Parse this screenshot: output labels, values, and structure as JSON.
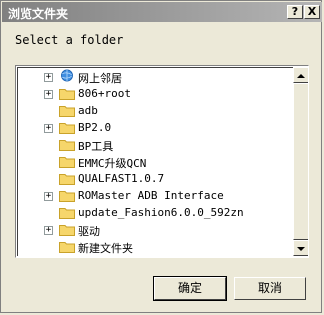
{
  "window": {
    "title": "浏览文件夹",
    "help_label": "?",
    "close_label": "X"
  },
  "prompt": "Select a folder",
  "tree": {
    "items": [
      {
        "label": "网上邻居",
        "expander": "+",
        "icon": "network-places-icon"
      },
      {
        "label": "806+root",
        "expander": "+",
        "icon": "folder-icon"
      },
      {
        "label": "adb",
        "expander": "",
        "icon": "folder-icon"
      },
      {
        "label": "BP2.0",
        "expander": "+",
        "icon": "folder-icon"
      },
      {
        "label": "BP工具",
        "expander": "",
        "icon": "folder-icon"
      },
      {
        "label": "EMMC升级QCN",
        "expander": "",
        "icon": "folder-icon"
      },
      {
        "label": "QUALFAST1.0.7",
        "expander": "",
        "icon": "folder-icon"
      },
      {
        "label": "ROMaster ADB Interface",
        "expander": "+",
        "icon": "folder-icon"
      },
      {
        "label": "update_Fashion6.0.0_592zn",
        "expander": "",
        "icon": "folder-icon"
      },
      {
        "label": "驱动",
        "expander": "+",
        "icon": "folder-icon"
      },
      {
        "label": "新建文件夹",
        "expander": "",
        "icon": "folder-icon"
      }
    ]
  },
  "buttons": {
    "ok": "确定",
    "cancel": "取消"
  },
  "colors": {
    "dialog_bg": "#ece9d8",
    "title_bar": "#808080",
    "folder_yellow": "#f6d66b"
  }
}
